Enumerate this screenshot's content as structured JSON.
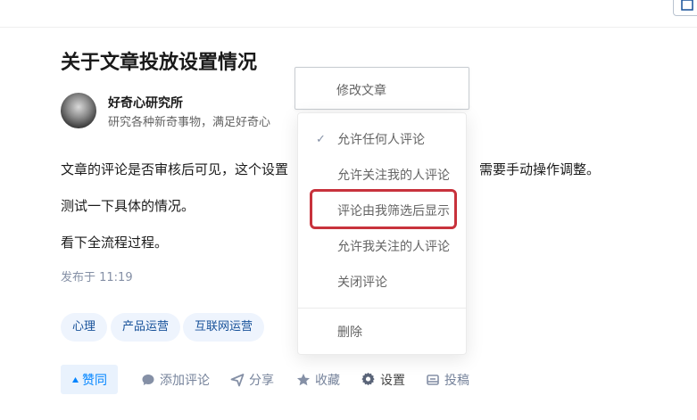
{
  "article": {
    "title": "关于文章投放设置情况",
    "author_name": "好奇心研究所",
    "author_bio": "研究各种新奇事物，满足好奇心",
    "paragraphs": [
      "文章的评论是否审核后可见，这个设置",
      "测试一下具体的情况。",
      "看下全流程过程。"
    ],
    "paragraph1_tail": "需要手动操作调整。",
    "published": "发布于 11:19",
    "tags": [
      "心理",
      "产品运营",
      "互联网运营"
    ]
  },
  "actions": {
    "vote": "赞同",
    "comment": "添加评论",
    "share": "分享",
    "favorite": "收藏",
    "settings": "设置",
    "submit": "投稿"
  },
  "edit_menu": {
    "label": "修改文章"
  },
  "comment_menu": {
    "items": [
      {
        "label": "允许任何人评论",
        "checked": true
      },
      {
        "label": "允许关注我的人评论",
        "checked": false
      },
      {
        "label": "评论由我筛选后显示",
        "checked": false
      },
      {
        "label": "允许我关注的人评论",
        "checked": false
      },
      {
        "label": "关闭评论",
        "checked": false
      }
    ],
    "delete_label": "删除",
    "check_glyph": "✓"
  },
  "colors": {
    "accent": "#0084ff",
    "tag_text": "#175199",
    "tag_bg": "#eef4fd",
    "highlight": "#c8323c",
    "muted": "#76839b"
  },
  "icons": [
    "write-icon",
    "triangle-up-icon",
    "comment-icon",
    "share-icon",
    "star-icon",
    "gear-icon",
    "submit-icon",
    "check-icon"
  ]
}
